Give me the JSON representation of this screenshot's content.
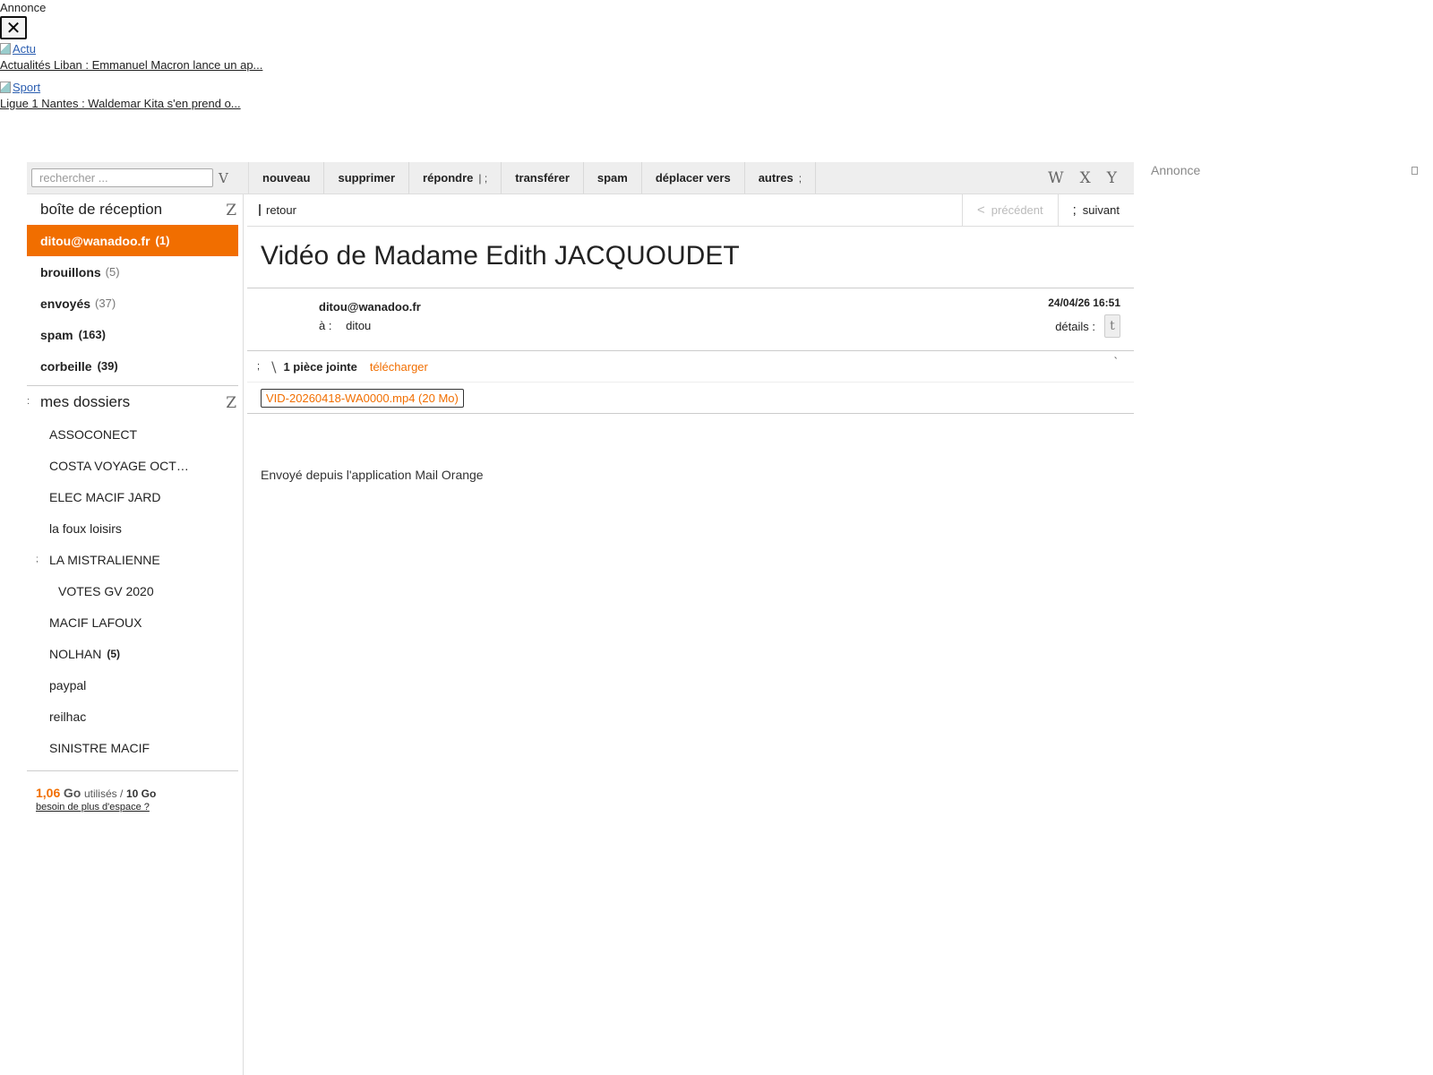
{
  "ad_top": {
    "label": "Annonce",
    "close_label": "✕",
    "items": [
      {
        "img_alt": "Actu",
        "text": "Actualités Liban : Emmanuel Macron lance un ap..."
      },
      {
        "img_alt": "Sport",
        "text": "Ligue 1 Nantes : Waldemar Kita s'en prend o..."
      }
    ]
  },
  "ad_right": {
    "label": "Annonce"
  },
  "toolbar": {
    "search_placeholder": "rechercher ...",
    "search_icon": "V",
    "buttons": {
      "new": "nouveau",
      "delete": "supprimer",
      "reply": "répondre",
      "reply_caret": "| ;",
      "forward": "transférer",
      "spam": "spam",
      "move": "déplacer vers",
      "other": "autres",
      "other_caret": ";"
    },
    "right_icons": [
      "W",
      "X",
      "Y"
    ]
  },
  "sidebar": {
    "inbox_title": "boîte de réception",
    "collapse_icon": "Z",
    "mailboxes": [
      {
        "label": "ditou@wanadoo.fr",
        "count": "(1)"
      },
      {
        "label": "brouillons",
        "count": "(5)"
      },
      {
        "label": "envoyés",
        "count": "(37)"
      },
      {
        "label": "spam",
        "count": "(163)"
      },
      {
        "label": "corbeille",
        "count": "(39)"
      }
    ],
    "folders_title": "mes dossiers",
    "folders_toggle": ":",
    "folders": [
      {
        "label": "ASSOCONECT"
      },
      {
        "label": "COSTA VOYAGE OCT…"
      },
      {
        "label": "ELEC MACIF JARD"
      },
      {
        "label": "la foux loisirs"
      },
      {
        "label": "LA MISTRALIENNE",
        "toggle": ";"
      },
      {
        "label": "VOTES GV 2020"
      },
      {
        "label": "MACIF LAFOUX"
      },
      {
        "label": "NOLHAN",
        "count": "(5)"
      },
      {
        "label": "paypal"
      },
      {
        "label": "reilhac"
      },
      {
        "label": "SINISTRE MACIF"
      }
    ],
    "quota": {
      "used": "1,06",
      "used_unit": "Go",
      "used_text": "utilisés /",
      "total": "10 Go",
      "more_link": "besoin de plus d'espace ?"
    }
  },
  "message": {
    "back": "retour",
    "prev": "précédent",
    "prev_arrow": "<",
    "next": "suivant",
    "next_arrow": ";",
    "subject": "Vidéo de Madame Edith JACQUOUDET",
    "from": "ditou@wanadoo.fr",
    "to_label": "à :",
    "to_value": "ditou",
    "date": "24/04/26 16:51",
    "details_label": "détails :",
    "details_icon": "t",
    "attachments": {
      "toggle": ";",
      "clip_icon": "\\",
      "count_label": "1 pièce jointe",
      "download": "télécharger",
      "more": "`",
      "file": "VID-20260418-WA0000.mp4 (20 Mo)"
    },
    "body": "Envoyé depuis l'application Mail Orange"
  },
  "colors": {
    "accent": "#f16e00"
  }
}
